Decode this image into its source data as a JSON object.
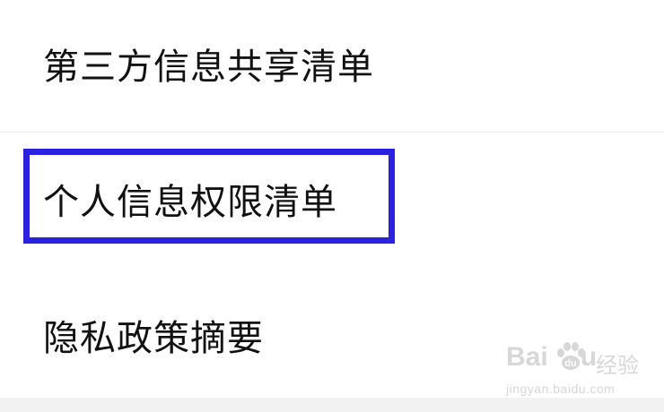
{
  "menu": {
    "items": [
      {
        "label": "第三方信息共享清单"
      },
      {
        "label": "个人信息权限清单",
        "highlighted": true
      },
      {
        "label": "隐私政策摘要"
      }
    ]
  },
  "highlight": {
    "color": "#2a22e0"
  },
  "watermark": {
    "brand_left": "Bai",
    "brand_right": "u",
    "brand_cn": "经验",
    "url": "jingyan.baidu.com",
    "icon": "paw-icon"
  }
}
